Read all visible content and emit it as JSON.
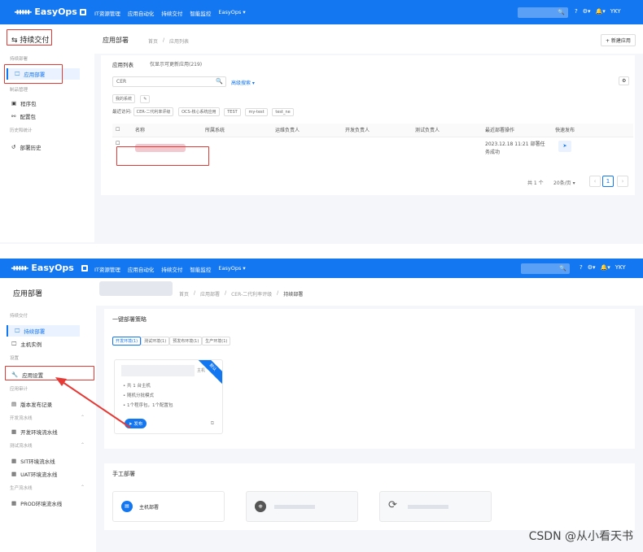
{
  "brand": "EasyOps",
  "nav": [
    "IT资源管理",
    "应用自动化",
    "持续交付",
    "智能监控",
    "EasyOps ▾"
  ],
  "user": "YKY",
  "panel1": {
    "sidebar_title": "持续交付",
    "sections": [
      "持续部署",
      "制品管理",
      "历史和统计"
    ],
    "items": [
      "应用部署",
      "程序包",
      "配置包",
      "部署历史"
    ],
    "page_title": "应用部署",
    "breadcrumb": [
      "首页",
      "/",
      "应用列表"
    ],
    "new_button": "+ 新建应用",
    "list_label": "应用列表",
    "list_hint": "仅显示可更新应用(219)",
    "search_value": "CER",
    "advanced": "高级搜索 ▾",
    "my_systems": "我的系统",
    "recent_label": "最近访问:",
    "recent_tags": [
      "CER-二代利率评级",
      "OCS-核心系统应用",
      "TEST",
      "my-test",
      "test_ne"
    ],
    "columns": [
      "名称",
      "所属系统",
      "运维负责人",
      "开发负责人",
      "测试负责人",
      "最近部署操作",
      "快速发布"
    ],
    "row_last_op": "2023.12.18 11:21 部署任务成功",
    "pager_total": "共 1 个",
    "pager_size": "20条/页 ▾",
    "pager_page": "1"
  },
  "panel2": {
    "sidebar_title": "应用部署",
    "sections": [
      "持续交付",
      "设置",
      "应用审计",
      "开发流水线",
      "测试流水线",
      "生产流水线"
    ],
    "items": [
      "持续部署",
      "主机实例",
      "应用设置",
      "版本发布记录",
      "开发环境流水线",
      "SIT环境流水线",
      "UAT环境流水线",
      "PROD环境流水线"
    ],
    "breadcrumb": [
      "首页",
      "/",
      "应用部署",
      "/",
      "CER-二代利率评级",
      "/",
      "持续部署"
    ],
    "strategy_title": "一键部署策略",
    "env_tabs": [
      "开发环境(1)",
      "测试环境(1)",
      "预发布环境(1)",
      "生产环境(1)"
    ],
    "card_tag": "主机",
    "card_badge": "默认",
    "card_lines": [
      "共 1 台主机",
      "随机分批模式",
      "1个程序包，1个配置包"
    ],
    "publish": "发布",
    "manual_title": "手工部署",
    "manual_cards": [
      "主机部署"
    ],
    "watermark": "CSDN @从小看天书"
  }
}
